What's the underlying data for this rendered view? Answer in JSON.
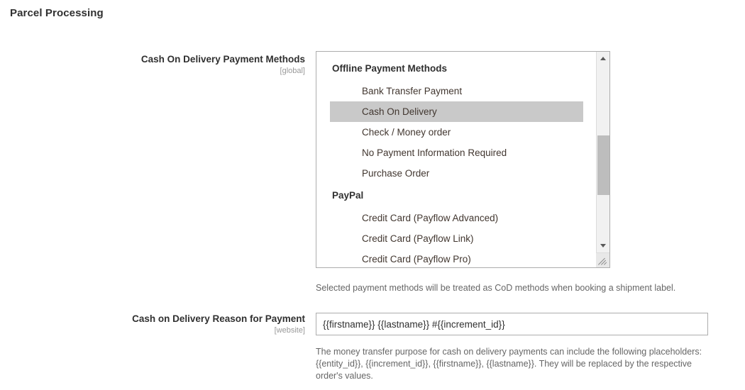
{
  "page": {
    "title": "Parcel Processing"
  },
  "fields": [
    {
      "label": "Cash On Delivery Payment Methods",
      "scope": "[global]",
      "note": "Selected payment methods will be treated as CoD methods when booking a shipment label.",
      "groups": [
        {
          "label": "Offline Payment Methods",
          "options": [
            {
              "label": "Bank Transfer Payment",
              "selected": false
            },
            {
              "label": "Cash On Delivery",
              "selected": true
            },
            {
              "label": "Check / Money order",
              "selected": false
            },
            {
              "label": "No Payment Information Required",
              "selected": false
            },
            {
              "label": "Purchase Order",
              "selected": false
            }
          ]
        },
        {
          "label": "PayPal",
          "options": [
            {
              "label": "Credit Card (Payflow Advanced)",
              "selected": false
            },
            {
              "label": "Credit Card (Payflow Link)",
              "selected": false
            },
            {
              "label": "Credit Card (Payflow Pro)",
              "selected": false
            }
          ]
        }
      ]
    },
    {
      "label": "Cash on Delivery Reason for Payment",
      "scope": "[website]",
      "value": "{{firstname}} {{lastname}} #{{increment_id}}",
      "placeholder": "",
      "note": "The money transfer purpose for cash on delivery payments can include the following placeholders: {{entity_id}}, {{increment_id}}, {{firstname}}, {{lastname}}. They will be replaced by the respective order's values."
    }
  ],
  "colors": {
    "selected_row": "#c9c9c9",
    "border": "#adadad",
    "note_text": "#666666",
    "scope_text": "#999999",
    "label_text": "#303030"
  }
}
